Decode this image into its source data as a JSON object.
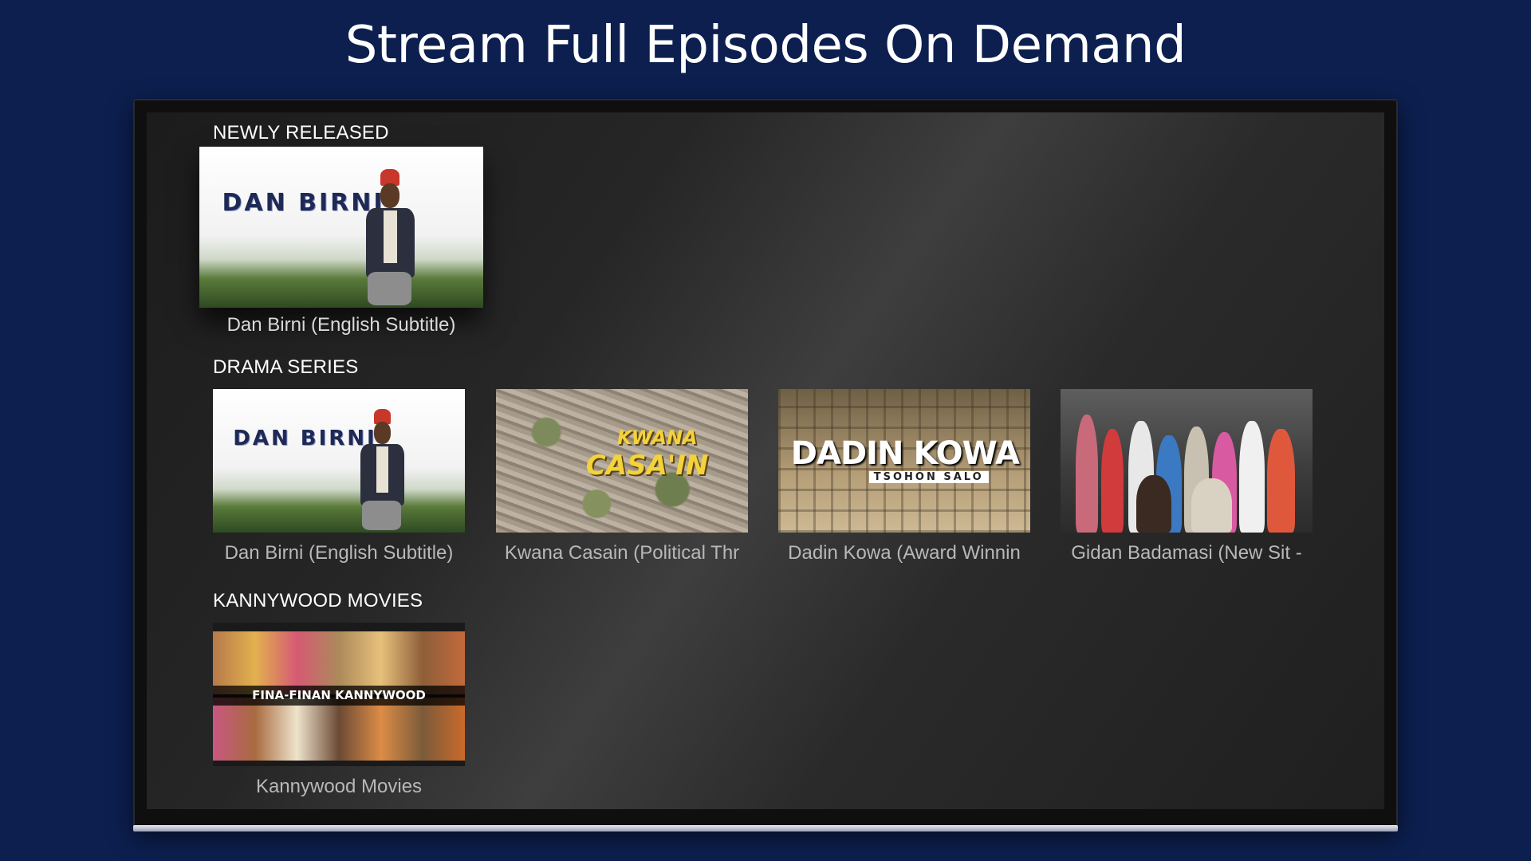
{
  "header": {
    "title": "Stream Full Episodes On Demand"
  },
  "sections": {
    "newly_released": {
      "title": "NEWLY RELEASED",
      "items": [
        {
          "caption": "Dan Birni (English Subtitle)",
          "art_text": "DAN BIRNI"
        }
      ]
    },
    "drama_series": {
      "title": "DRAMA SERIES",
      "items": [
        {
          "caption": "Dan Birni (English Subtitle)",
          "art_text": "DAN BIRNI"
        },
        {
          "caption": "Kwana Casain (Political Thr",
          "art_text_1": "KWANA",
          "art_text_2": "CASA'IN"
        },
        {
          "caption": "Dadin Kowa (Award Winnin",
          "art_text_1": "DADIN KOWA",
          "art_text_2": "TSOHON SALO"
        },
        {
          "caption": "Gidan Badamasi (New Sit -"
        }
      ]
    },
    "kannywood_movies": {
      "title": "KANNYWOOD MOVIES",
      "items": [
        {
          "caption": "Kannywood Movies",
          "art_text": "FINA-FINAN KANNYWOOD"
        }
      ]
    }
  },
  "colors": {
    "background": "#0c1f4f",
    "screen": "#262626",
    "caption": "#b8b8b8",
    "section_title": "#ffffff"
  }
}
